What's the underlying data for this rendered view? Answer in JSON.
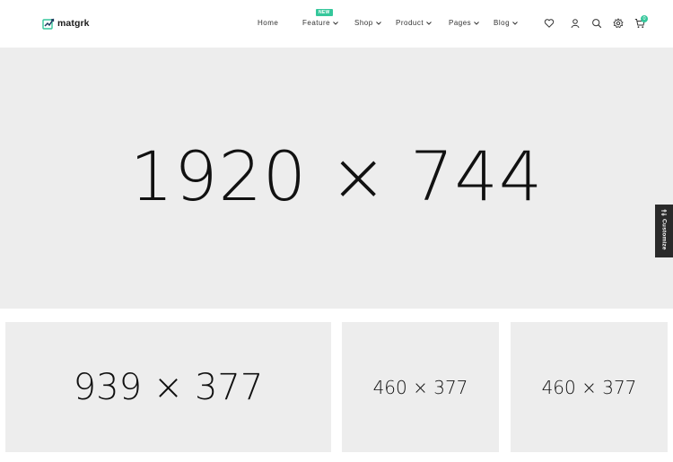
{
  "brand": {
    "name": "matgrk",
    "logo_icon": "chart-doc-icon"
  },
  "nav": {
    "items": [
      {
        "label": "Home",
        "dropdown": false
      },
      {
        "label": "Feature",
        "dropdown": true,
        "badge": "NEW"
      },
      {
        "label": "Shop",
        "dropdown": true
      },
      {
        "label": "Product",
        "dropdown": true
      },
      {
        "label": "Pages",
        "dropdown": true
      },
      {
        "label": "Blog",
        "dropdown": true
      }
    ]
  },
  "header_icons": [
    "heart-icon",
    "user-icon",
    "search-icon",
    "gear-icon",
    "cart-icon"
  ],
  "cart": {
    "count": "0"
  },
  "hero": {
    "placeholder": "1920 × 744"
  },
  "customize": {
    "label": "Customize"
  },
  "banners": [
    {
      "placeholder": "939 × 377"
    },
    {
      "placeholder": "460 × 377"
    },
    {
      "placeholder": "460 × 377"
    }
  ],
  "colors": {
    "accent": "#35c79b",
    "placeholder_bg": "#ededed",
    "customize_bg": "#2a2a2a"
  }
}
